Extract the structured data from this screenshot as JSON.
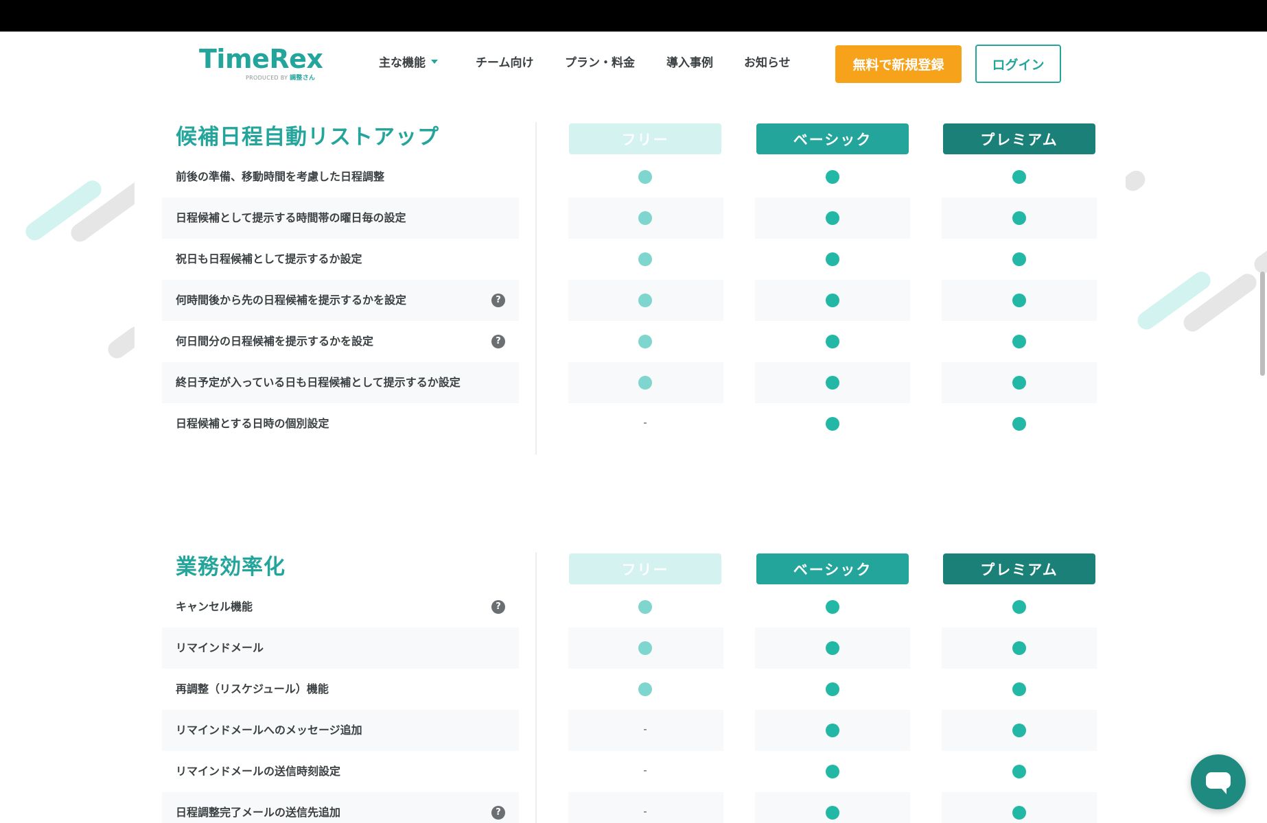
{
  "header": {
    "logo": "TimeRex",
    "logo_sub_prefix": "PRODUCED BY",
    "logo_sub_brand": "調整さん",
    "nav": [
      {
        "label": "主な機能",
        "has_dropdown": true
      },
      {
        "label": "チーム向け"
      },
      {
        "label": "プラン・料金"
      },
      {
        "label": "導入事例"
      },
      {
        "label": "お知らせ"
      }
    ],
    "signup_label": "無料で新規登録",
    "login_label": "ログイン"
  },
  "plans": [
    "フリー",
    "ベーシック",
    "プレミアム"
  ],
  "colors": {
    "brand": "#23a59c",
    "plan_free": "#d3f2f0",
    "plan_basic": "#23a59c",
    "plan_premium": "#1b8078",
    "signup": "#f7a21b",
    "mark_free": "#7fd6ce",
    "mark_paid": "#23b8a6"
  },
  "sections": [
    {
      "title": "候補日程自動リストアップ",
      "rows": [
        {
          "label": "前後の準備、移動時間を考慮した日程調整",
          "help": false,
          "free": true,
          "basic": true,
          "premium": true
        },
        {
          "label": "日程候補として提示する時間帯の曜日毎の設定",
          "help": false,
          "free": true,
          "basic": true,
          "premium": true
        },
        {
          "label": "祝日も日程候補として提示するか設定",
          "help": false,
          "free": true,
          "basic": true,
          "premium": true
        },
        {
          "label": "何時間後から先の日程候補を提示するかを設定",
          "help": true,
          "free": true,
          "basic": true,
          "premium": true
        },
        {
          "label": "何日間分の日程候補を提示するかを設定",
          "help": true,
          "free": true,
          "basic": true,
          "premium": true
        },
        {
          "label": "終日予定が入っている日も日程候補として提示するか設定",
          "help": false,
          "free": true,
          "basic": true,
          "premium": true
        },
        {
          "label": "日程候補とする日時の個別設定",
          "help": false,
          "free": false,
          "basic": true,
          "premium": true
        }
      ]
    },
    {
      "title": "業務効率化",
      "rows": [
        {
          "label": "キャンセル機能",
          "help": true,
          "free": true,
          "basic": true,
          "premium": true
        },
        {
          "label": "リマインドメール",
          "help": false,
          "free": true,
          "basic": true,
          "premium": true
        },
        {
          "label": "再調整（リスケジュール）機能",
          "help": false,
          "free": true,
          "basic": true,
          "premium": true
        },
        {
          "label": "リマインドメールへのメッセージ追加",
          "help": false,
          "free": false,
          "basic": true,
          "premium": true
        },
        {
          "label": "リマインドメールの送信時刻設定",
          "help": false,
          "free": false,
          "basic": true,
          "premium": true
        },
        {
          "label": "日程調整完了メールの送信先追加",
          "help": true,
          "free": false,
          "basic": true,
          "premium": true
        }
      ]
    }
  ],
  "dash_symbol": "-",
  "help_symbol": "?"
}
